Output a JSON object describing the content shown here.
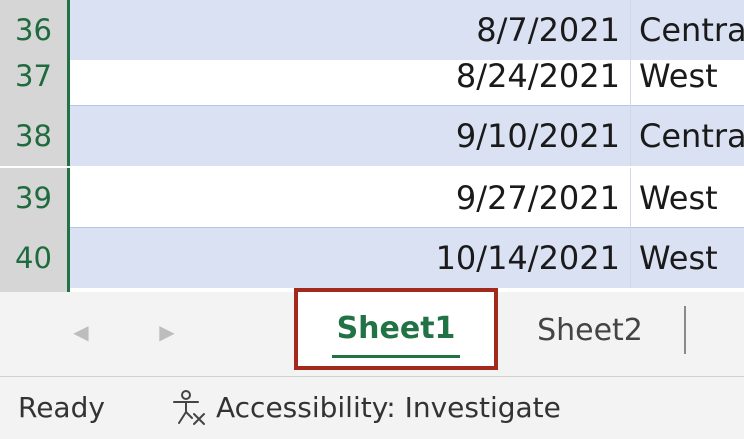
{
  "rows": [
    {
      "num": "36",
      "date": "8/7/2021",
      "region": "Central"
    },
    {
      "num": "37",
      "date": "8/24/2021",
      "region": "West"
    },
    {
      "num": "38",
      "date": "9/10/2021",
      "region": "Central"
    },
    {
      "num": "39",
      "date": "9/27/2021",
      "region": "West"
    },
    {
      "num": "40",
      "date": "10/14/2021",
      "region": "West"
    }
  ],
  "tabs": {
    "prev_icon": "chevron-left-icon",
    "next_icon": "chevron-right-icon",
    "sheet1": "Sheet1",
    "sheet2": "Sheet2",
    "active": "Sheet1"
  },
  "status": {
    "ready": "Ready",
    "accessibility": "Accessibility: Investigate",
    "accessibility_icon": "accessibility-icon"
  },
  "colors": {
    "accent": "#217346",
    "highlight_border": "#a4291d",
    "band": "#d9e1f2"
  }
}
